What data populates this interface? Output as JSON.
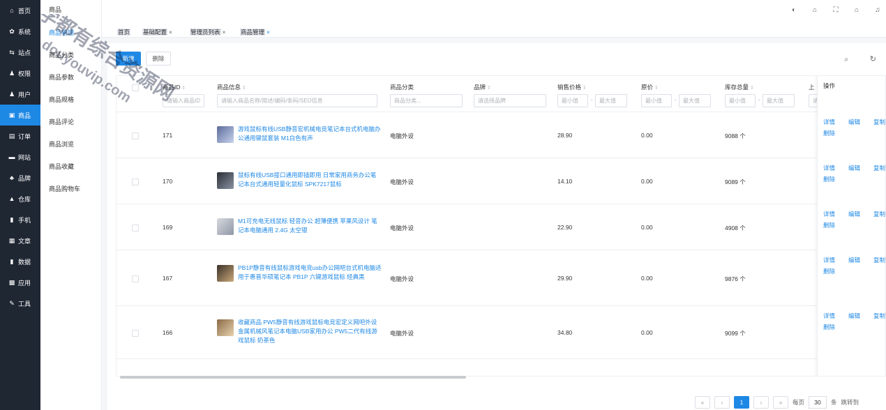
{
  "sidebar": {
    "items": [
      {
        "label": "首页",
        "icon": "home-icon",
        "glyph": "⌂"
      },
      {
        "label": "系统",
        "icon": "gear-icon",
        "glyph": "✿"
      },
      {
        "label": "站点",
        "icon": "site-icon",
        "glyph": "⇆"
      },
      {
        "label": "权限",
        "icon": "permission-icon",
        "glyph": "♟"
      },
      {
        "label": "用户",
        "icon": "user-icon",
        "glyph": "♟"
      },
      {
        "label": "商品",
        "icon": "goods-icon",
        "glyph": "▣",
        "active": true
      },
      {
        "label": "订单",
        "icon": "order-icon",
        "glyph": "▤"
      },
      {
        "label": "网站",
        "icon": "website-icon",
        "glyph": "▬"
      },
      {
        "label": "品牌",
        "icon": "brand-icon",
        "glyph": "♣"
      },
      {
        "label": "仓库",
        "icon": "warehouse-icon",
        "glyph": "▲"
      },
      {
        "label": "手机",
        "icon": "phone-icon",
        "glyph": "▮"
      },
      {
        "label": "文章",
        "icon": "article-icon",
        "glyph": "▦"
      },
      {
        "label": "数据",
        "icon": "chart-icon",
        "glyph": "▮"
      },
      {
        "label": "应用",
        "icon": "apps-icon",
        "glyph": "▩"
      },
      {
        "label": "工具",
        "icon": "wrench-icon",
        "glyph": "✎"
      }
    ]
  },
  "submenu": {
    "title": "商品",
    "items": [
      "商品管理",
      "商品分类",
      "商品参数",
      "商品规格",
      "商品评论",
      "商品浏览",
      "商品收藏",
      "商品购物车"
    ]
  },
  "tabs": [
    {
      "label": "首页",
      "closable": false
    },
    {
      "label": "基础配置",
      "closable": true
    },
    {
      "label": "管理员列表",
      "closable": true
    },
    {
      "label": "商品管理",
      "closable": true,
      "active": true
    }
  ],
  "toolbar": {
    "add_label": "新增",
    "delete_label": "删除"
  },
  "table": {
    "columns": {
      "id": "商品ID",
      "info": "商品信息",
      "category": "商品分类",
      "brand": "品牌",
      "price": "销售价格",
      "original": "原价",
      "stock": "库存总量",
      "more": "上",
      "ops": "操作"
    },
    "filters": {
      "id": "请输入商品ID",
      "info": "请输入商品名称/简述/编码/条码/SEO信息",
      "category": "商品分类...",
      "brand": "请选择品牌",
      "min": "最小值",
      "max": "最大值",
      "more": "请"
    },
    "range_sep": "-",
    "ops": {
      "detail": "详情",
      "edit": "编辑",
      "copy": "复制",
      "delete": "删除"
    },
    "rows": [
      {
        "id": "171",
        "name": "游戏鼠标有线USB静音宏机械电竞笔记本台式机电脑办公通用键鼠套装 M1白色有声",
        "category": "电脑外设",
        "price": "28.90",
        "original": "0.00",
        "stock": "9088 个"
      },
      {
        "id": "170",
        "name": "鼠标有线USB接口通用即插即用 日常家用商务办公笔记本台式通用轻量化鼠标 SPK7217鼠标",
        "category": "电脑外设",
        "price": "14.10",
        "original": "0.00",
        "stock": "9089 个"
      },
      {
        "id": "169",
        "name": "M1可充电无线鼠标 轻音办公 超薄便携 苹果风设计 笔记本电脑通用 2.4G 太空银",
        "category": "电脑外设",
        "price": "22.90",
        "original": "0.00",
        "stock": "4908 个"
      },
      {
        "id": "167",
        "name": "PB1P静音有线鼠标游戏电竞usb办公网吧台式机电脑适用于惠普华硕笔记本 PB1P 六键游戏鼠标 经典黑",
        "category": "电脑外设",
        "price": "29.90",
        "original": "0.00",
        "stock": "9876 个"
      },
      {
        "id": "166",
        "name": "收藏商品 PW5静音有线游戏鼠标电竞宏定义网吧外设金属机械风笔记本电脑USB家用办公 PW5二代有线游戏鼠标 奶茶色",
        "category": "电脑外设",
        "price": "34.80",
        "original": "0.00",
        "stock": "9099 个"
      }
    ]
  },
  "pager": {
    "first": "«",
    "prev": "‹",
    "current": "1",
    "next": "›",
    "last": "»",
    "per_page_label": "每页",
    "per_page": "30",
    "unit": "条",
    "jump_label": "跳转到"
  },
  "watermark": {
    "line1": "学都有综合资源网",
    "line2": "douyouvip.com"
  }
}
